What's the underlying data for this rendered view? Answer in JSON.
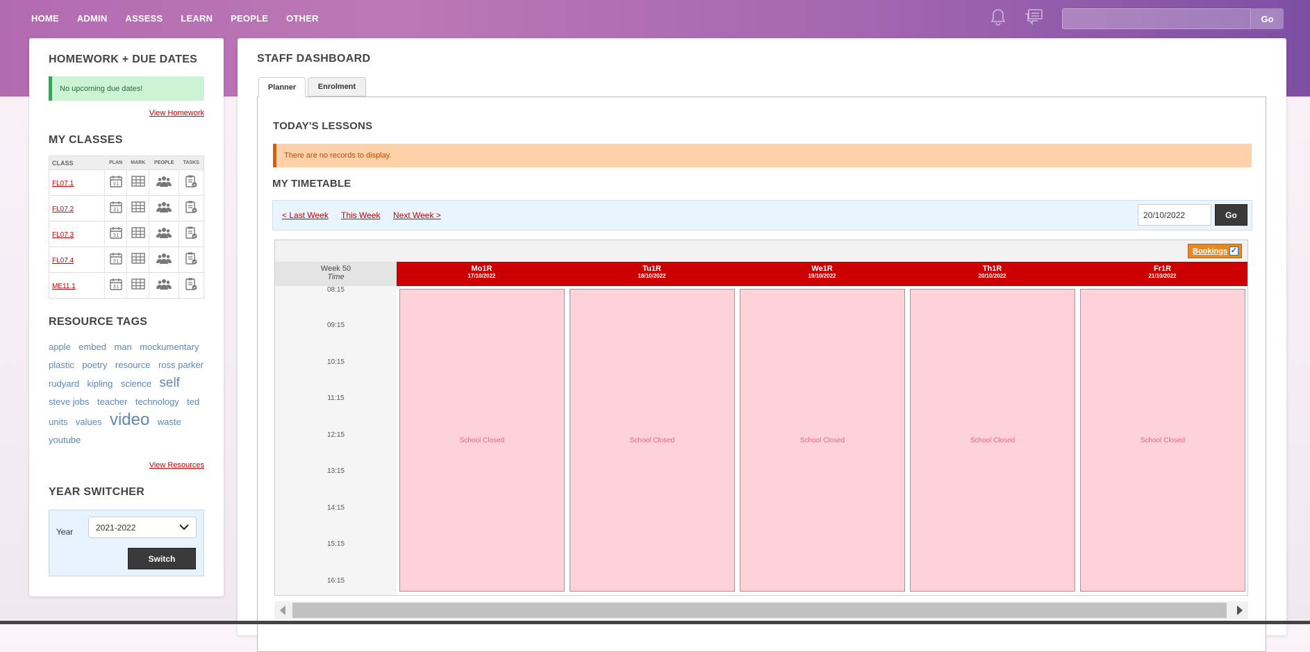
{
  "nav": {
    "items": [
      "HOME",
      "ADMIN",
      "ASSESS",
      "LEARN",
      "PEOPLE",
      "OTHER"
    ],
    "search_go": "Go"
  },
  "sidebar": {
    "homework": {
      "title": "HOMEWORK + DUE DATES",
      "notice": "No upcoming due dates!",
      "link": "View Homework"
    },
    "classes": {
      "title": "MY CLASSES",
      "headers": [
        "CLASS",
        "PLAN",
        "MARK",
        "PEOPLE",
        "TASKS"
      ],
      "rows": [
        "FL07.1",
        "FL07.2",
        "FL07.3",
        "FL07.4",
        "ME11.1"
      ]
    },
    "tags": {
      "title": "RESOURCE TAGS",
      "items": [
        "apple",
        "embed",
        "man",
        "mockumentary",
        "plastic",
        "poetry",
        "resource",
        "ross parker",
        "rudyard",
        "kipling",
        "science",
        "self",
        "steve jobs",
        "teacher",
        "technology",
        "ted",
        "units",
        "values",
        "video",
        "waste",
        "youtube"
      ],
      "link": "View Resources"
    },
    "year": {
      "title": "YEAR SWITCHER",
      "label": "Year",
      "value": "2021-2022",
      "button": "Switch"
    }
  },
  "main": {
    "title": "STAFF DASHBOARD",
    "tabs": [
      "Planner",
      "Enrolment"
    ],
    "todays_lessons": {
      "title": "TODAY'S LESSONS",
      "notice": "There are no records to display."
    },
    "timetable": {
      "title": "MY TIMETABLE",
      "last_week": "< Last Week",
      "this_week": "This Week",
      "next_week": "Next Week >",
      "date": "20/10/2022",
      "go": "Go",
      "bookings": "Bookings",
      "week": "Week 50",
      "time_label": "Time",
      "times": [
        "08:15",
        "09:15",
        "10:15",
        "11:15",
        "12:15",
        "13:15",
        "14:15",
        "15:15",
        "16:15"
      ],
      "days": [
        {
          "name": "Mo1R",
          "date": "17/10/2022",
          "status": "School Closed"
        },
        {
          "name": "Tu1R",
          "date": "18/10/2022",
          "status": "School Closed"
        },
        {
          "name": "We1R",
          "date": "19/10/2022",
          "status": "School Closed"
        },
        {
          "name": "Th1R",
          "date": "20/10/2022",
          "status": "School Closed"
        },
        {
          "name": "Fr1R",
          "date": "21/10/2022",
          "status": "School Closed"
        }
      ]
    }
  },
  "colors": {
    "header_start": "#b36bb0",
    "header_end": "#7d4fa4",
    "day_header": "#cc0000",
    "closed_cell": "#ffd1d9",
    "link": "#cc0000"
  }
}
